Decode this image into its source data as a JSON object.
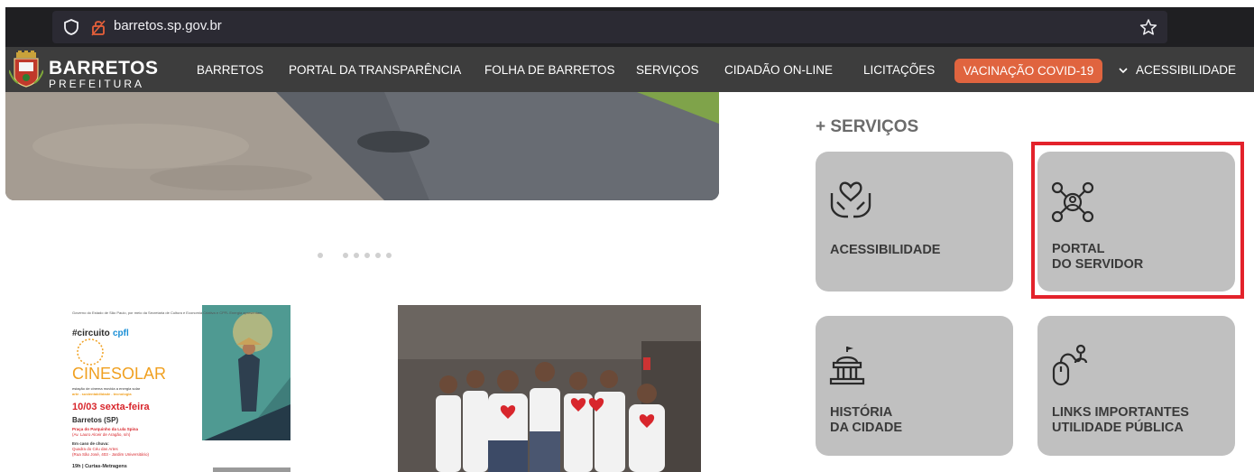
{
  "browser": {
    "url": "barretos.sp.gov.br"
  },
  "logo": {
    "title": "BARRETOS",
    "subtitle": "PREFEITURA"
  },
  "nav": {
    "items": [
      "BARRETOS",
      "PORTAL DA TRANSPARÊNCIA",
      "FOLHA DE BARRETOS",
      "SERVIÇOS",
      "CIDADÃO ON-LINE",
      "LICITAÇÕES"
    ],
    "covid": "VACINAÇÃO COVID-19",
    "accessibility": "ACESSIBILIDADE"
  },
  "services": {
    "title": "+ SERVIÇOS",
    "tiles": [
      {
        "label": "ACESSIBILIDADE",
        "icon": "hands-heart-icon"
      },
      {
        "label": "PORTAL\nDO SERVIDOR",
        "icon": "network-user-icon"
      },
      {
        "label": "HISTÓRIA\nDA CIDADE",
        "icon": "building-icon"
      },
      {
        "label": "LINKS IMPORTANTES\nUTILIDADE PÚBLICA",
        "icon": "links-mouse-icon"
      }
    ]
  },
  "poster": {
    "header": "Governo do Estado de São Paulo, por meio da Secretaria de Cultura e Economia Criativa e CPFL Energia apresentam",
    "hashtag_a": "#circuito",
    "hashtag_b": "cpfl",
    "brand": "CINESOLAR",
    "tagline": "estação de cinema movida a energia solar",
    "tagline2": "arte . sustentabilidade . tecnologia",
    "date": "10/03 sexta-feira",
    "city": "Barretos (SP)",
    "venue": "Praça do Parquinho da Lula Spina",
    "address": "(Av. Lauro Alceir de Aragão, s/n)",
    "rain": "Em caso de chuva:",
    "rain2": "Quadra do Céu das Artes",
    "rain3": "(Rua São José, 403 - Jardim Universitário)",
    "session": "19h | Curtas-Metragens"
  },
  "colors": {
    "nav_bg": "#3d3d3d",
    "covid": "#e0643f",
    "tile": "#c0c0c0",
    "highlight": "#e3222b",
    "accent_blue": "#1a8fd6",
    "accent_orange": "#f0a020",
    "poster_red": "#d8262c"
  }
}
